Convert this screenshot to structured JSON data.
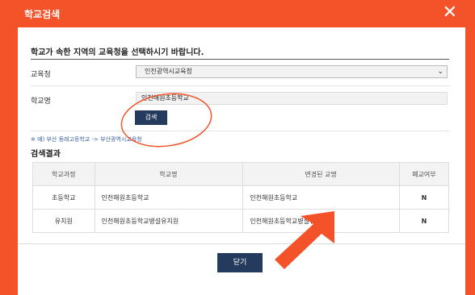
{
  "dialog": {
    "title": "학교검색",
    "close_icon": "close-icon",
    "instruction": "학교가 속한 지역의 교육청을 선택하시기 바랍니다."
  },
  "form": {
    "office_label": "교육청",
    "office_value": "인천광역시교육청",
    "school_label": "학교명",
    "school_value": "인천해원초등학교",
    "search_button": "검색",
    "example": "※ 예) 부산 동래고등학교 -> 부산광역시교육청"
  },
  "results": {
    "title": "검색결과",
    "columns": [
      "학교과정",
      "학교명",
      "변경된 교명",
      "폐교여부"
    ],
    "rows": [
      [
        "초등학교",
        "인천해원초등학교",
        "인천해원초등학교",
        "N"
      ],
      [
        "유치원",
        "인천해원초등학교병설유치원",
        "인천해원초등학교병설유치원",
        "N"
      ]
    ]
  },
  "footer": {
    "close_button": "닫기"
  },
  "colors": {
    "accent": "#f4532a",
    "button": "#243b5e"
  }
}
